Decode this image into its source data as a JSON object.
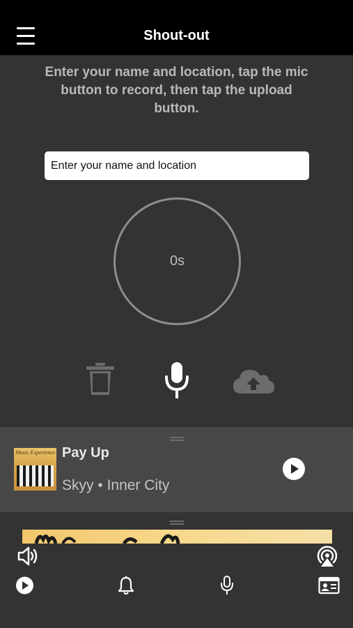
{
  "header": {
    "title": "Shout-out",
    "menu_icon": "hamburger-menu-icon"
  },
  "recorder": {
    "instructions": "Enter your name and location, tap the mic button to record, then tap the upload button.",
    "name_input": {
      "value": "",
      "placeholder": "Enter your name and location"
    },
    "timer": "0s",
    "controls": [
      "trash-icon",
      "microphone-icon",
      "cloud-upload-icon"
    ]
  },
  "now_playing": {
    "title": "Pay Up",
    "artist": "Skyy",
    "separator": "•",
    "album": "Inner City",
    "album_art_text": "Music Experience"
  },
  "player_bar": {
    "tabs": [
      "play-icon",
      "bell-icon",
      "microphone-icon",
      "contact-card-icon"
    ]
  },
  "colors": {
    "background": "#333333",
    "header": "#000000",
    "sheet": "#474747",
    "text_muted": "#b9b9b9"
  }
}
